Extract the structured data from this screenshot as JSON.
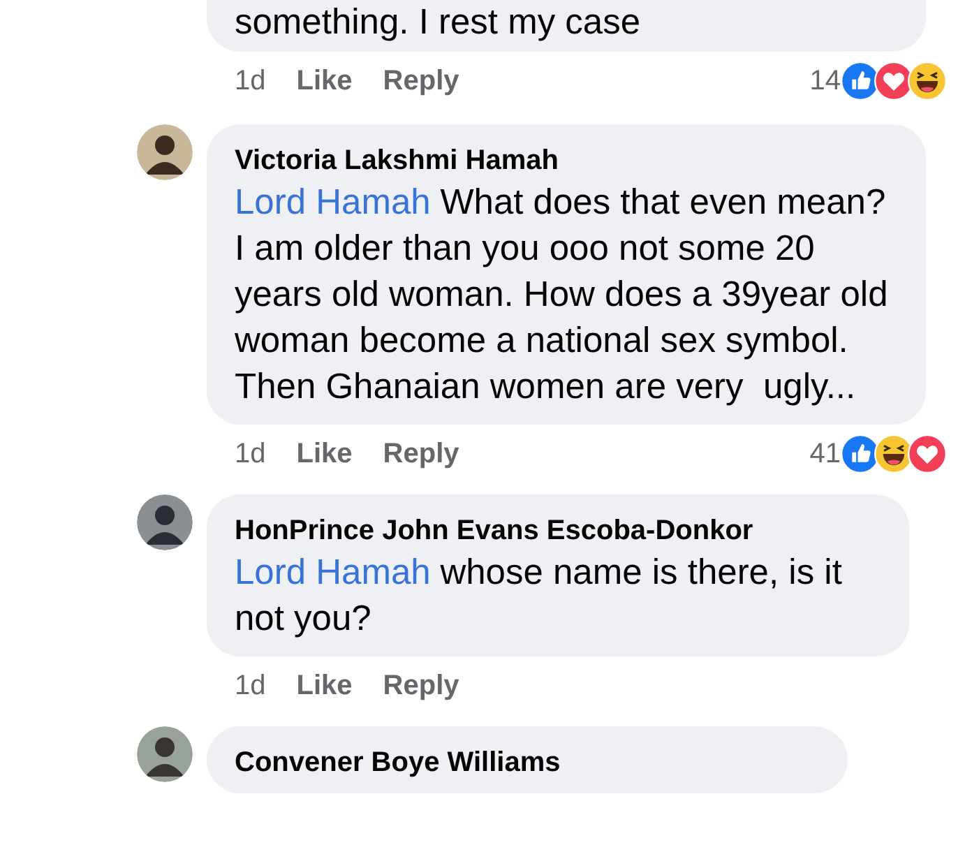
{
  "comments": [
    {
      "text": "something. I rest my case",
      "time": "1d",
      "like": "Like",
      "reply": "Reply",
      "count": "14",
      "reactions": [
        {
          "kind": "like"
        },
        {
          "kind": "love"
        },
        {
          "kind": "haha"
        }
      ]
    },
    {
      "author": "Victoria Lakshmi Hamah",
      "mention": "Lord Hamah",
      "text": "What does that even mean? I am older than you ooo not some 20 years old woman. How does a 39year old woman become a national sex symbol. Then Ghanaian women are very  ugly...",
      "time": "1d",
      "like": "Like",
      "reply": "Reply",
      "count": "41",
      "reactions": [
        {
          "kind": "like"
        },
        {
          "kind": "haha"
        },
        {
          "kind": "love"
        }
      ]
    },
    {
      "author": "HonPrince John Evans Escoba-Donkor",
      "mention": "Lord Hamah",
      "text": "whose name is there, is it not you?",
      "time": "1d",
      "like": "Like",
      "reply": "Reply"
    },
    {
      "author": "Convener Boye Williams"
    }
  ]
}
